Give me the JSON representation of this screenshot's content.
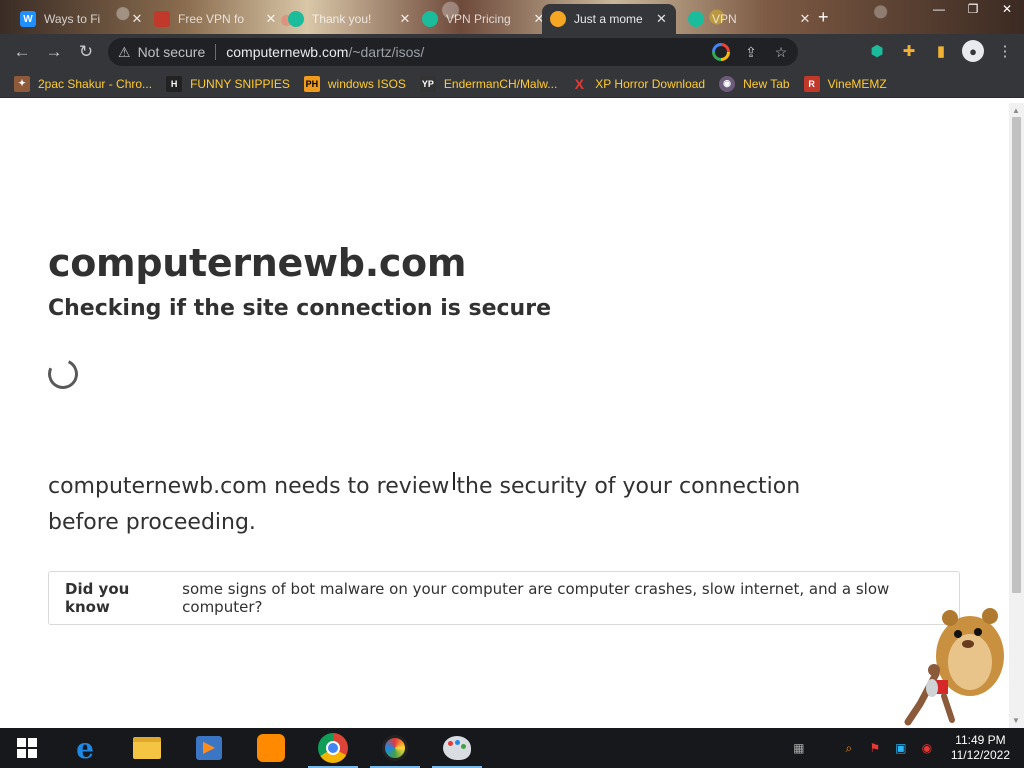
{
  "browser": {
    "tabs": [
      {
        "title": "Ways to Fi",
        "favicon": "W",
        "favicon_color": "#1e90ff"
      },
      {
        "title": "Free VPN fo",
        "favicon": "",
        "favicon_color": "#c0392b"
      },
      {
        "title": "Thank you!",
        "favicon": "",
        "favicon_color": "#1abc9c"
      },
      {
        "title": "VPN Pricing",
        "favicon": "",
        "favicon_color": "#1abc9c"
      },
      {
        "title": "Just a mome",
        "favicon": "",
        "favicon_color": "#f5a623",
        "active": true
      },
      {
        "title": "VPN",
        "favicon": "",
        "favicon_color": "#1abc9c"
      }
    ],
    "new_tab_label": "+",
    "security_label": "Not secure",
    "url_host": "computernewb.com",
    "url_path": "/~dartz/isos/",
    "bookmarks": [
      {
        "label": "2pac Shakur - Chro...",
        "icon": "puzzle-icon",
        "color": "#8e5a3a"
      },
      {
        "label": "FUNNY SNIPPIES",
        "icon": "H",
        "color": "#222222"
      },
      {
        "label": "windows ISOS",
        "icon": "PH",
        "color": "#f29a1c"
      },
      {
        "label": "EndermanCH/Malw...",
        "icon": "YP",
        "color": "#333333"
      },
      {
        "label": "XP Horror Download",
        "icon": "X",
        "color": "#c0392b"
      },
      {
        "label": "New Tab",
        "icon": "globe-icon",
        "color": "#6c5b7b"
      },
      {
        "label": "VineMEMZ",
        "icon": "R",
        "color": "#c0392b"
      }
    ]
  },
  "page": {
    "site_name": "computernewb.com",
    "heading": "Checking if the site connection is secure",
    "body": "computernewb.com needs to review the security of your connection before proceeding.",
    "did_you_know_label": "Did you know",
    "did_you_know_text": "some signs of bot malware on your computer are computer crashes, slow internet, and a slow computer?"
  },
  "taskbar": {
    "time": "11:49 PM",
    "date": "11/12/2022"
  }
}
